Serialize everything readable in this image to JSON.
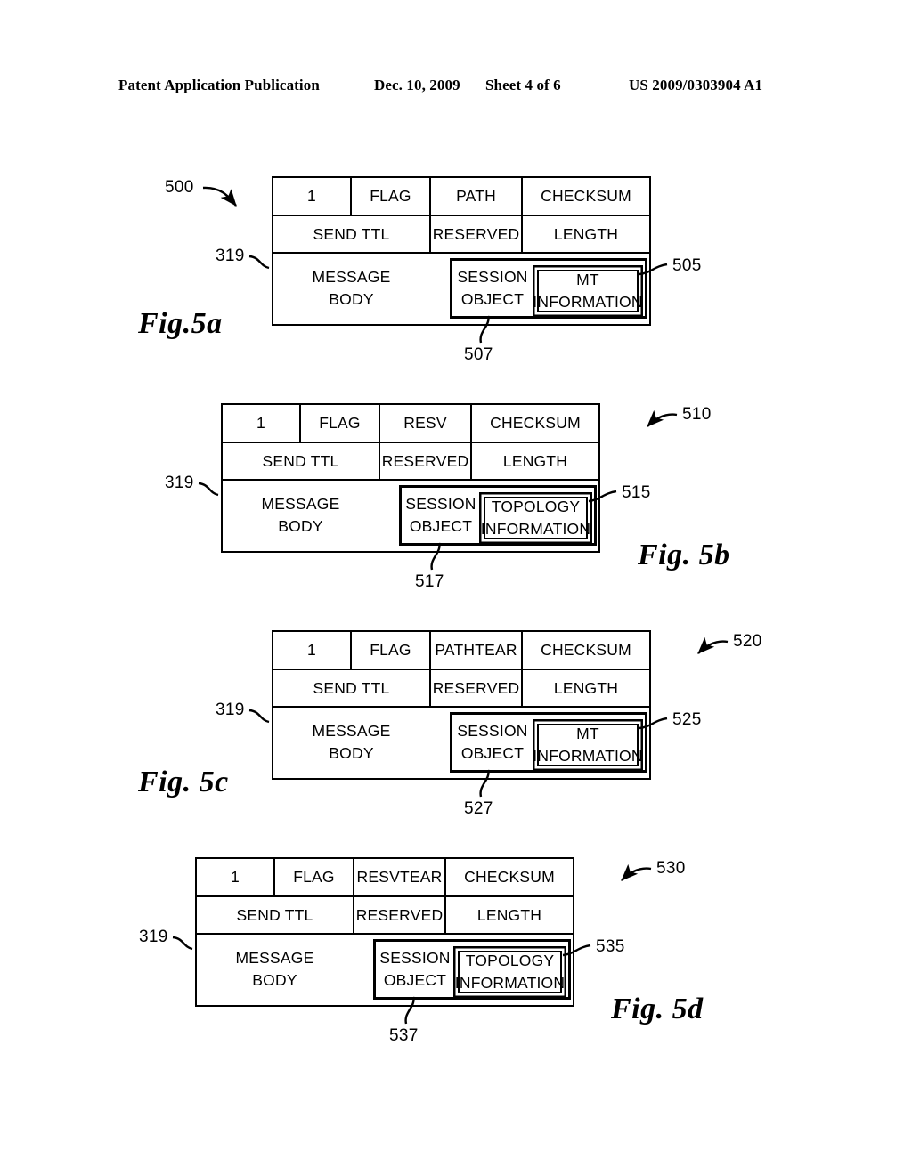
{
  "header": {
    "publication": "Patent Application Publication",
    "date": "Dec. 10, 2009",
    "sheet": "Sheet 4 of 6",
    "patent_number": "US 2009/0303904 A1"
  },
  "figures": [
    {
      "id": "fig5a",
      "caption": "Fig.5a",
      "ref_main": "500",
      "ref_body": "319",
      "ref_info": "505",
      "ref_session": "507",
      "row1": [
        "1",
        "FLAG",
        "PATH",
        "CHECKSUM"
      ],
      "row2": [
        "SEND TTL",
        "RESERVED",
        "LENGTH"
      ],
      "body_label": [
        "MESSAGE",
        "BODY"
      ],
      "session_label": [
        "SESSION",
        "OBJECT"
      ],
      "info_label": [
        "MT",
        "INFORMATION"
      ]
    },
    {
      "id": "fig5b",
      "caption": "Fig. 5b",
      "ref_main": "510",
      "ref_body": "319",
      "ref_info": "515",
      "ref_session": "517",
      "row1": [
        "1",
        "FLAG",
        "RESV",
        "CHECKSUM"
      ],
      "row2": [
        "SEND TTL",
        "RESERVED",
        "LENGTH"
      ],
      "body_label": [
        "MESSAGE",
        "BODY"
      ],
      "session_label": [
        "SESSION",
        "OBJECT"
      ],
      "info_label": [
        "TOPOLOGY",
        "INFORMATION"
      ]
    },
    {
      "id": "fig5c",
      "caption": "Fig. 5c",
      "ref_main": "520",
      "ref_body": "319",
      "ref_info": "525",
      "ref_session": "527",
      "row1": [
        "1",
        "FLAG",
        "PATHTEAR",
        "CHECKSUM"
      ],
      "row2": [
        "SEND TTL",
        "RESERVED",
        "LENGTH"
      ],
      "body_label": [
        "MESSAGE",
        "BODY"
      ],
      "session_label": [
        "SESSION",
        "OBJECT"
      ],
      "info_label": [
        "MT",
        "INFORMATION"
      ]
    },
    {
      "id": "fig5d",
      "caption": "Fig. 5d",
      "ref_main": "530",
      "ref_body": "319",
      "ref_info": "535",
      "ref_session": "537",
      "row1": [
        "1",
        "FLAG",
        "RESVTEAR",
        "CHECKSUM"
      ],
      "row2": [
        "SEND TTL",
        "RESERVED",
        "LENGTH"
      ],
      "body_label": [
        "MESSAGE",
        "BODY"
      ],
      "session_label": [
        "SESSION",
        "OBJECT"
      ],
      "info_label": [
        "TOPOLOGY",
        "INFORMATION"
      ]
    }
  ]
}
